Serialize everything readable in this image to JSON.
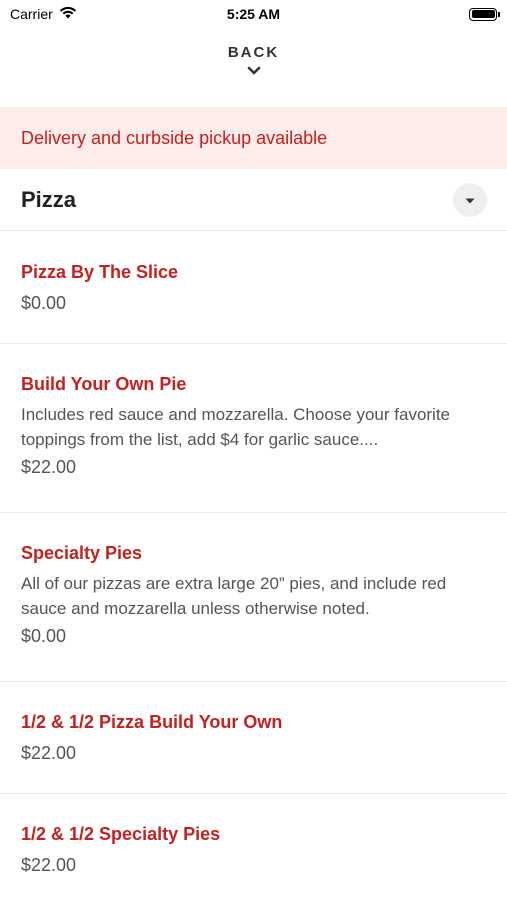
{
  "status_bar": {
    "carrier": "Carrier",
    "time": "5:25 AM"
  },
  "nav": {
    "back_label": "BACK"
  },
  "banner": {
    "text": "Delivery and curbside pickup available"
  },
  "section": {
    "title": "Pizza"
  },
  "menu_items": [
    {
      "name": "Pizza By The Slice",
      "description": "",
      "price": "$0.00"
    },
    {
      "name": "Build Your Own Pie",
      "description": "Includes red sauce and mozzarella. Choose your favorite toppings from the list, add $4 for garlic sauce....",
      "price": "$22.00"
    },
    {
      "name": "Specialty Pies",
      "description": "All of our pizzas are extra large 20” pies, and include red sauce and mozzarella unless otherwise noted.",
      "price": "$0.00"
    },
    {
      "name": "1/2 & 1/2 Pizza Build Your Own",
      "description": "",
      "price": "$22.00"
    },
    {
      "name": "1/2 & 1/2 Specialty Pies",
      "description": "",
      "price": "$22.00"
    }
  ],
  "colors": {
    "accent": "#c8201e",
    "banner_bg": "#fdecea"
  },
  "icons": {
    "wifi": "wifi-icon",
    "battery": "battery-icon",
    "back": "chevron-down-icon",
    "dropdown": "caret-down-icon"
  }
}
